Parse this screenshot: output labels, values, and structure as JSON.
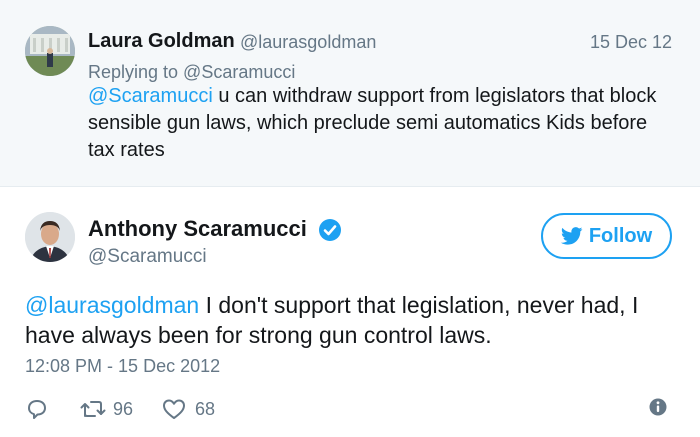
{
  "reply": {
    "name": "Laura Goldman",
    "handle": "@laurasgoldman",
    "date": "15 Dec 12",
    "replying_to": "Replying to @Scaramucci",
    "mention": "@Scaramucci",
    "text": " u can withdraw support from legislators that block sensible gun laws, which preclude semi automatics Kids before tax rates"
  },
  "tweet": {
    "name": "Anthony Scaramucci",
    "handle": "@Scaramucci",
    "follow_label": "Follow",
    "mention": "@laurasgoldman",
    "text": " I don't support that legislation, never had, I have always been for strong gun control laws.",
    "timestamp": "12:08 PM - 15 Dec 2012",
    "retweets": "96",
    "likes": "68"
  },
  "colors": {
    "accent": "#1da1f2",
    "muted": "#657786",
    "reply_bg": "#f5f8fa"
  },
  "icons": [
    "reply-icon",
    "retweet-icon",
    "heart-icon",
    "info-icon",
    "verified-icon",
    "twitter-bird-icon"
  ]
}
